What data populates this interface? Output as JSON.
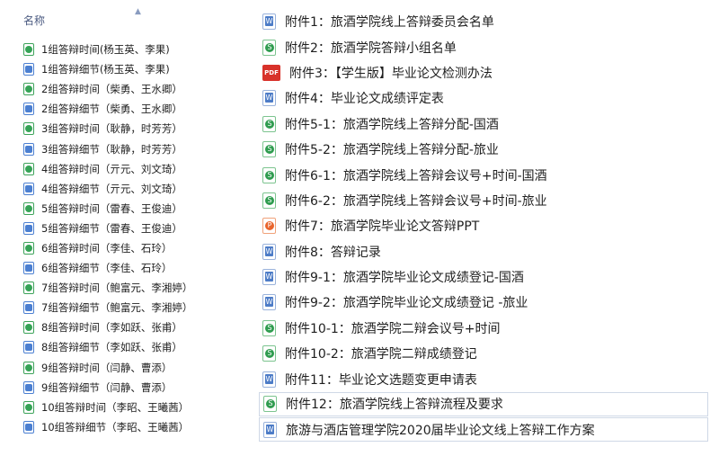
{
  "left_pane": {
    "column_header": "名称",
    "sort_indicator_icon": "sort-caret-up-icon",
    "files": [
      {
        "name": "1组答辩时间(杨玉英、李果)",
        "icon": "spreadsheet-file-icon"
      },
      {
        "name": "1组答辩细节(杨玉英、李果)",
        "icon": "document-file-icon"
      },
      {
        "name": "2组答辩时间（柴勇、王水卿）",
        "icon": "spreadsheet-file-icon"
      },
      {
        "name": "2组答辩细节（柴勇、王水卿）",
        "icon": "document-file-icon"
      },
      {
        "name": "3组答辩时间（耿静，时芳芳）",
        "icon": "spreadsheet-file-icon"
      },
      {
        "name": "3组答辩细节（耿静，时芳芳）",
        "icon": "document-file-icon"
      },
      {
        "name": "4组答辩时间（亓元、刘文琦）",
        "icon": "spreadsheet-file-icon"
      },
      {
        "name": "4组答辩细节（亓元、刘文琦）",
        "icon": "document-file-icon"
      },
      {
        "name": "5组答辩时间（雷春、王俊迪）",
        "icon": "spreadsheet-file-icon"
      },
      {
        "name": "5组答辩细节（雷春、王俊迪）",
        "icon": "document-file-icon"
      },
      {
        "name": "6组答辩时间（李佳、石玲）",
        "icon": "spreadsheet-file-icon"
      },
      {
        "name": "6组答辩细节（李佳、石玲）",
        "icon": "document-file-icon"
      },
      {
        "name": "7组答辩时间（鲍富元、李湘婷）",
        "icon": "spreadsheet-file-icon"
      },
      {
        "name": "7组答辩细节（鲍富元、李湘婷）",
        "icon": "document-file-icon"
      },
      {
        "name": "8组答辩时间（李如跃、张甫）",
        "icon": "spreadsheet-file-icon"
      },
      {
        "name": "8组答辩细节（李如跃、张甫）",
        "icon": "document-file-icon"
      },
      {
        "name": "9组答辩时间（闫静、曹添）",
        "icon": "spreadsheet-file-icon"
      },
      {
        "name": "9组答辩细节（闫静、曹添）",
        "icon": "document-file-icon"
      },
      {
        "name": "10组答辩时间（李昭、王曦茜）",
        "icon": "spreadsheet-file-icon"
      },
      {
        "name": "10组答辩细节（李昭、王曦茜）",
        "icon": "document-file-icon"
      }
    ]
  },
  "right_pane": {
    "files": [
      {
        "name": "附件1：旅酒学院线上答辩委员会名单",
        "icon": "document-file-icon",
        "type": "doc"
      },
      {
        "name": "附件2：旅酒学院答辩小组名单",
        "icon": "spreadsheet-file-icon",
        "type": "xls"
      },
      {
        "name": "附件3：【学生版】毕业论文检测办法",
        "icon": "pdf-file-icon",
        "type": "pdf"
      },
      {
        "name": "附件4：毕业论文成绩评定表",
        "icon": "document-file-icon",
        "type": "doc"
      },
      {
        "name": "附件5-1：旅酒学院线上答辩分配-国酒",
        "icon": "spreadsheet-file-icon",
        "type": "xls"
      },
      {
        "name": "附件5-2：旅酒学院线上答辩分配-旅业",
        "icon": "spreadsheet-file-icon",
        "type": "xls"
      },
      {
        "name": "附件6-1：旅酒学院线上答辩会议号+时间-国酒",
        "icon": "spreadsheet-file-icon",
        "type": "xls"
      },
      {
        "name": "附件6-2：旅酒学院线上答辩会议号+时间-旅业",
        "icon": "spreadsheet-file-icon",
        "type": "xls"
      },
      {
        "name": "附件7：旅酒学院毕业论文答辩PPT",
        "icon": "presentation-file-icon",
        "type": "ppt"
      },
      {
        "name": "附件8：答辩记录",
        "icon": "document-file-icon",
        "type": "doc"
      },
      {
        "name": "附件9-1：旅酒学院毕业论文成绩登记-国酒",
        "icon": "document-file-icon",
        "type": "doc"
      },
      {
        "name": "附件9-2：旅酒学院毕业论文成绩登记 -旅业",
        "icon": "document-file-icon",
        "type": "doc"
      },
      {
        "name": "附件10-1：旅酒学院二辩会议号+时间",
        "icon": "spreadsheet-file-icon",
        "type": "xls"
      },
      {
        "name": "附件10-2：旅酒学院二辩成绩登记",
        "icon": "spreadsheet-file-icon",
        "type": "xls"
      },
      {
        "name": "附件11：毕业论文选题变更申请表",
        "icon": "document-file-icon",
        "type": "doc"
      },
      {
        "name": "附件12：旅酒学院线上答辩流程及要求",
        "icon": "spreadsheet-file-icon",
        "type": "xls"
      },
      {
        "name": "旅游与酒店管理学院2020届毕业论文线上答辩工作方案",
        "icon": "document-file-icon",
        "type": "doc"
      }
    ]
  }
}
